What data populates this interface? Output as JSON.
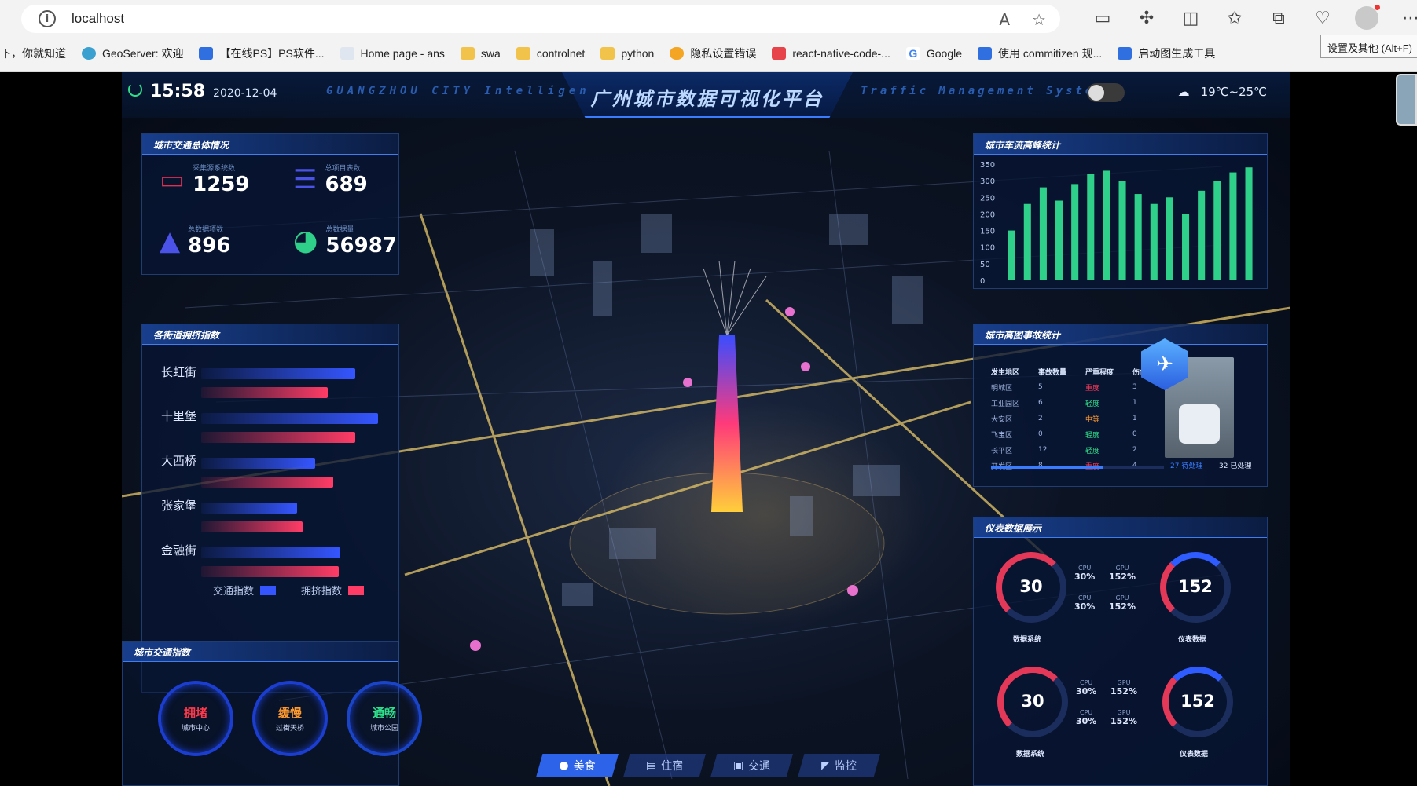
{
  "browser": {
    "url": "localhost",
    "tooltip": "设置及其他 (Alt+F)",
    "bookmarks": [
      {
        "label": "下，你就知道",
        "icon": "none"
      },
      {
        "label": "GeoServer: 欢迎",
        "icon": "geoserver-icon"
      },
      {
        "label": "【在线PS】PS软件...",
        "icon": "ps-icon"
      },
      {
        "label": "Home page - ans",
        "icon": "page-icon"
      },
      {
        "label": "swa",
        "icon": "folder-icon"
      },
      {
        "label": "controlnet",
        "icon": "folder-icon"
      },
      {
        "label": "python",
        "icon": "folder-icon"
      },
      {
        "label": "隐私设置错误",
        "icon": "cloud-icon"
      },
      {
        "label": "react-native-code-...",
        "icon": "bookmark-icon"
      },
      {
        "label": "Google",
        "icon": "google-icon"
      },
      {
        "label": "使用 commitizen 规...",
        "icon": "zhihu-icon"
      },
      {
        "label": "启动图生成工具",
        "icon": "rh-icon"
      }
    ]
  },
  "dashboard": {
    "time": "15:58",
    "date": "2020-12-04",
    "title": "广州城市数据可视化平台",
    "subtitle_left": "GUANGZHOU CITY Intelligen",
    "subtitle_right": "Traffic Management System",
    "weather": "19℃~25℃",
    "panels": {
      "overview_title": "城市交通总体情况",
      "congestion_title": "各街道拥挤指数",
      "index_title": "城市交通指数",
      "flow_title": "城市车流高峰统计",
      "accident_title": "城市高图事故统计",
      "gauges_title": "仪表数据展示"
    },
    "stats": [
      {
        "label": "采集源系统数",
        "value": "1259",
        "color": "#e02e55"
      },
      {
        "label": "总项目表数",
        "value": "689",
        "color": "#4b52e8"
      },
      {
        "label": "总数据项数",
        "value": "896",
        "color": "#4b52e8"
      },
      {
        "label": "总数据量",
        "value": "56987",
        "color": "#2fd08a"
      }
    ],
    "streets": [
      {
        "name": "长虹街",
        "traffic": 0.85,
        "congestion": 0.7
      },
      {
        "name": "十里堡",
        "traffic": 0.98,
        "congestion": 0.85
      },
      {
        "name": "大西桥",
        "traffic": 0.63,
        "congestion": 0.73
      },
      {
        "name": "张家堡",
        "traffic": 0.53,
        "congestion": 0.56
      },
      {
        "name": "金融街",
        "traffic": 0.77,
        "congestion": 0.76
      }
    ],
    "legend": {
      "traffic": "交通指数",
      "congestion": "拥挤指数"
    },
    "rings": [
      {
        "status": "拥堵",
        "place": "城市中心",
        "color": "#ff3a4c"
      },
      {
        "status": "缓慢",
        "place": "过街天桥",
        "color": "#ff9a2e"
      },
      {
        "status": "通畅",
        "place": "城市公园",
        "color": "#2fe08a"
      }
    ],
    "accident": {
      "headers": [
        "发生地区",
        "事故数量",
        "严重程度",
        "伤亡人数"
      ],
      "rows": [
        [
          "明城区",
          "5",
          "重度",
          "3"
        ],
        [
          "工业园区",
          "6",
          "轻度",
          "1"
        ],
        [
          "大安区",
          "2",
          "中等",
          "1"
        ],
        [
          "飞宝区",
          "0",
          "轻度",
          "0"
        ],
        [
          "长平区",
          "12",
          "轻度",
          "2"
        ],
        [
          "开发区",
          "8",
          "重度",
          "4"
        ]
      ],
      "severity_colors": {
        "重度": "#ff3a5a",
        "轻度": "#2fe08a",
        "中等": "#ff9a2e"
      },
      "pending": "27 待处理",
      "handled": "32 已处理",
      "progress": 0.65
    },
    "gauges": [
      {
        "value": "30",
        "name": "数据系统",
        "cpu": "30%",
        "gpu": "152%",
        "cpu2": "30%",
        "gpu2": "152%"
      },
      {
        "value": "152",
        "name": "仪表数据"
      },
      {
        "value": "30",
        "name": "数据系统",
        "cpu": "30%",
        "gpu": "152%",
        "cpu2": "30%",
        "gpu2": "152%"
      },
      {
        "value": "152",
        "name": "仪表数据"
      }
    ],
    "pct_labels": {
      "cpu": "CPU",
      "gpu": "GPU"
    },
    "nav": [
      {
        "label": "美食",
        "active": true
      },
      {
        "label": "住宿",
        "active": false
      },
      {
        "label": "交通",
        "active": false
      },
      {
        "label": "监控",
        "active": false
      }
    ]
  },
  "chart_data": {
    "type": "bar",
    "title": "城市车流高峰统计",
    "ylim": [
      0,
      350
    ],
    "yticks": [
      0,
      50,
      100,
      150,
      200,
      250,
      300,
      350
    ],
    "values": [
      150,
      230,
      280,
      240,
      290,
      320,
      330,
      300,
      260,
      230,
      250,
      200,
      270,
      300,
      325,
      340
    ],
    "color": "#2fd08a"
  }
}
